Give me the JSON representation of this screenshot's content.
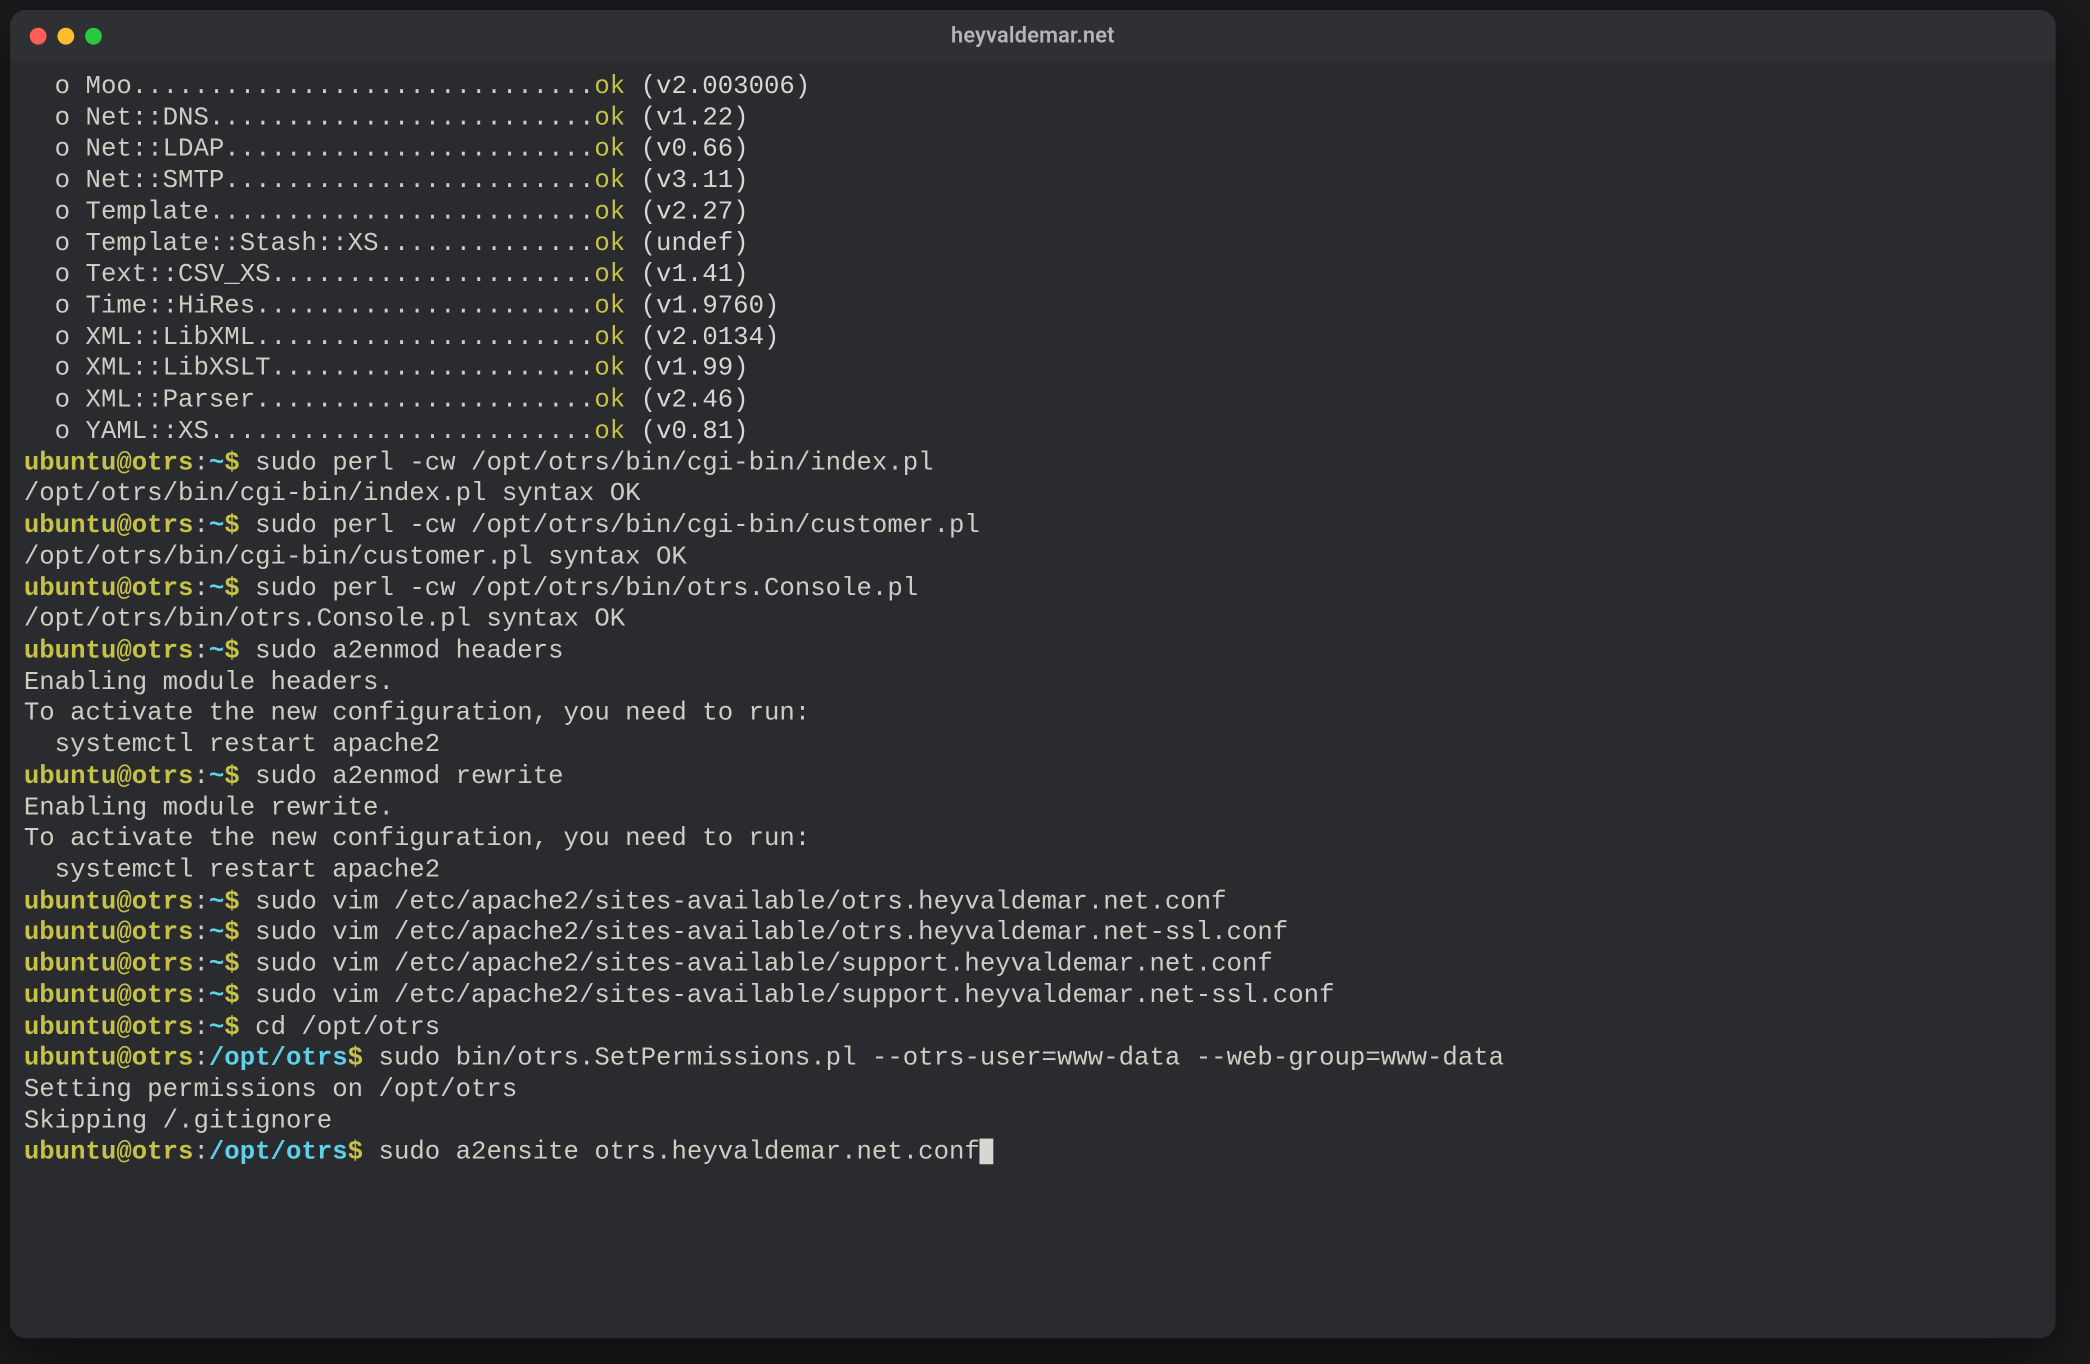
{
  "window": {
    "title": "heyvaldemar.net"
  },
  "prompt": {
    "user": "ubuntu",
    "host": "otrs",
    "home_cwd": "~",
    "dollar": "$"
  },
  "modules": [
    {
      "bullet": "o",
      "name": "Moo",
      "dots": "..............................",
      "ok": "ok",
      "version": "(v2.003006)"
    },
    {
      "bullet": "o",
      "name": "Net::DNS",
      "dots": ".........................",
      "ok": "ok",
      "version": "(v1.22)"
    },
    {
      "bullet": "o",
      "name": "Net::LDAP",
      "dots": "........................",
      "ok": "ok",
      "version": "(v0.66)"
    },
    {
      "bullet": "o",
      "name": "Net::SMTP",
      "dots": "........................",
      "ok": "ok",
      "version": "(v3.11)"
    },
    {
      "bullet": "o",
      "name": "Template",
      "dots": ".........................",
      "ok": "ok",
      "version": "(v2.27)"
    },
    {
      "bullet": "o",
      "name": "Template::Stash::XS",
      "dots": "..............",
      "ok": "ok",
      "version": "(undef)"
    },
    {
      "bullet": "o",
      "name": "Text::CSV_XS",
      "dots": ".....................",
      "ok": "ok",
      "version": "(v1.41)"
    },
    {
      "bullet": "o",
      "name": "Time::HiRes",
      "dots": "......................",
      "ok": "ok",
      "version": "(v1.9760)"
    },
    {
      "bullet": "o",
      "name": "XML::LibXML",
      "dots": "......................",
      "ok": "ok",
      "version": "(v2.0134)"
    },
    {
      "bullet": "o",
      "name": "XML::LibXSLT",
      "dots": ".....................",
      "ok": "ok",
      "version": "(v1.99)"
    },
    {
      "bullet": "o",
      "name": "XML::Parser",
      "dots": "......................",
      "ok": "ok",
      "version": "(v2.46)"
    },
    {
      "bullet": "o",
      "name": "YAML::XS",
      "dots": ".........................",
      "ok": "ok",
      "version": "(v0.81)"
    }
  ],
  "lines": {
    "cmd1": "sudo perl -cw /opt/otrs/bin/cgi-bin/index.pl",
    "out1": "/opt/otrs/bin/cgi-bin/index.pl syntax OK",
    "cmd2": "sudo perl -cw /opt/otrs/bin/cgi-bin/customer.pl",
    "out2": "/opt/otrs/bin/cgi-bin/customer.pl syntax OK",
    "cmd3": "sudo perl -cw /opt/otrs/bin/otrs.Console.pl",
    "out3": "/opt/otrs/bin/otrs.Console.pl syntax OK",
    "cmd4": "sudo a2enmod headers",
    "out4a": "Enabling module headers.",
    "out4b": "To activate the new configuration, you need to run:",
    "out4c": "  systemctl restart apache2",
    "cmd5": "sudo a2enmod rewrite",
    "out5a": "Enabling module rewrite.",
    "out5b": "To activate the new configuration, you need to run:",
    "out5c": "  systemctl restart apache2",
    "cmd6": "sudo vim /etc/apache2/sites-available/otrs.heyvaldemar.net.conf",
    "cmd7": "sudo vim /etc/apache2/sites-available/otrs.heyvaldemar.net-ssl.conf",
    "cmd8": "sudo vim /etc/apache2/sites-available/support.heyvaldemar.net.conf",
    "cmd9": "sudo vim /etc/apache2/sites-available/support.heyvaldemar.net-ssl.conf",
    "cmd10": "cd /opt/otrs",
    "cwd2": "/opt/otrs",
    "cmd11": "sudo bin/otrs.SetPermissions.pl --otrs-user=www-data --web-group=www-data",
    "out11a": "Setting permissions on /opt/otrs",
    "out11b": "Skipping /.gitignore",
    "cmd12": "sudo a2ensite otrs.heyvaldemar.net.conf"
  }
}
